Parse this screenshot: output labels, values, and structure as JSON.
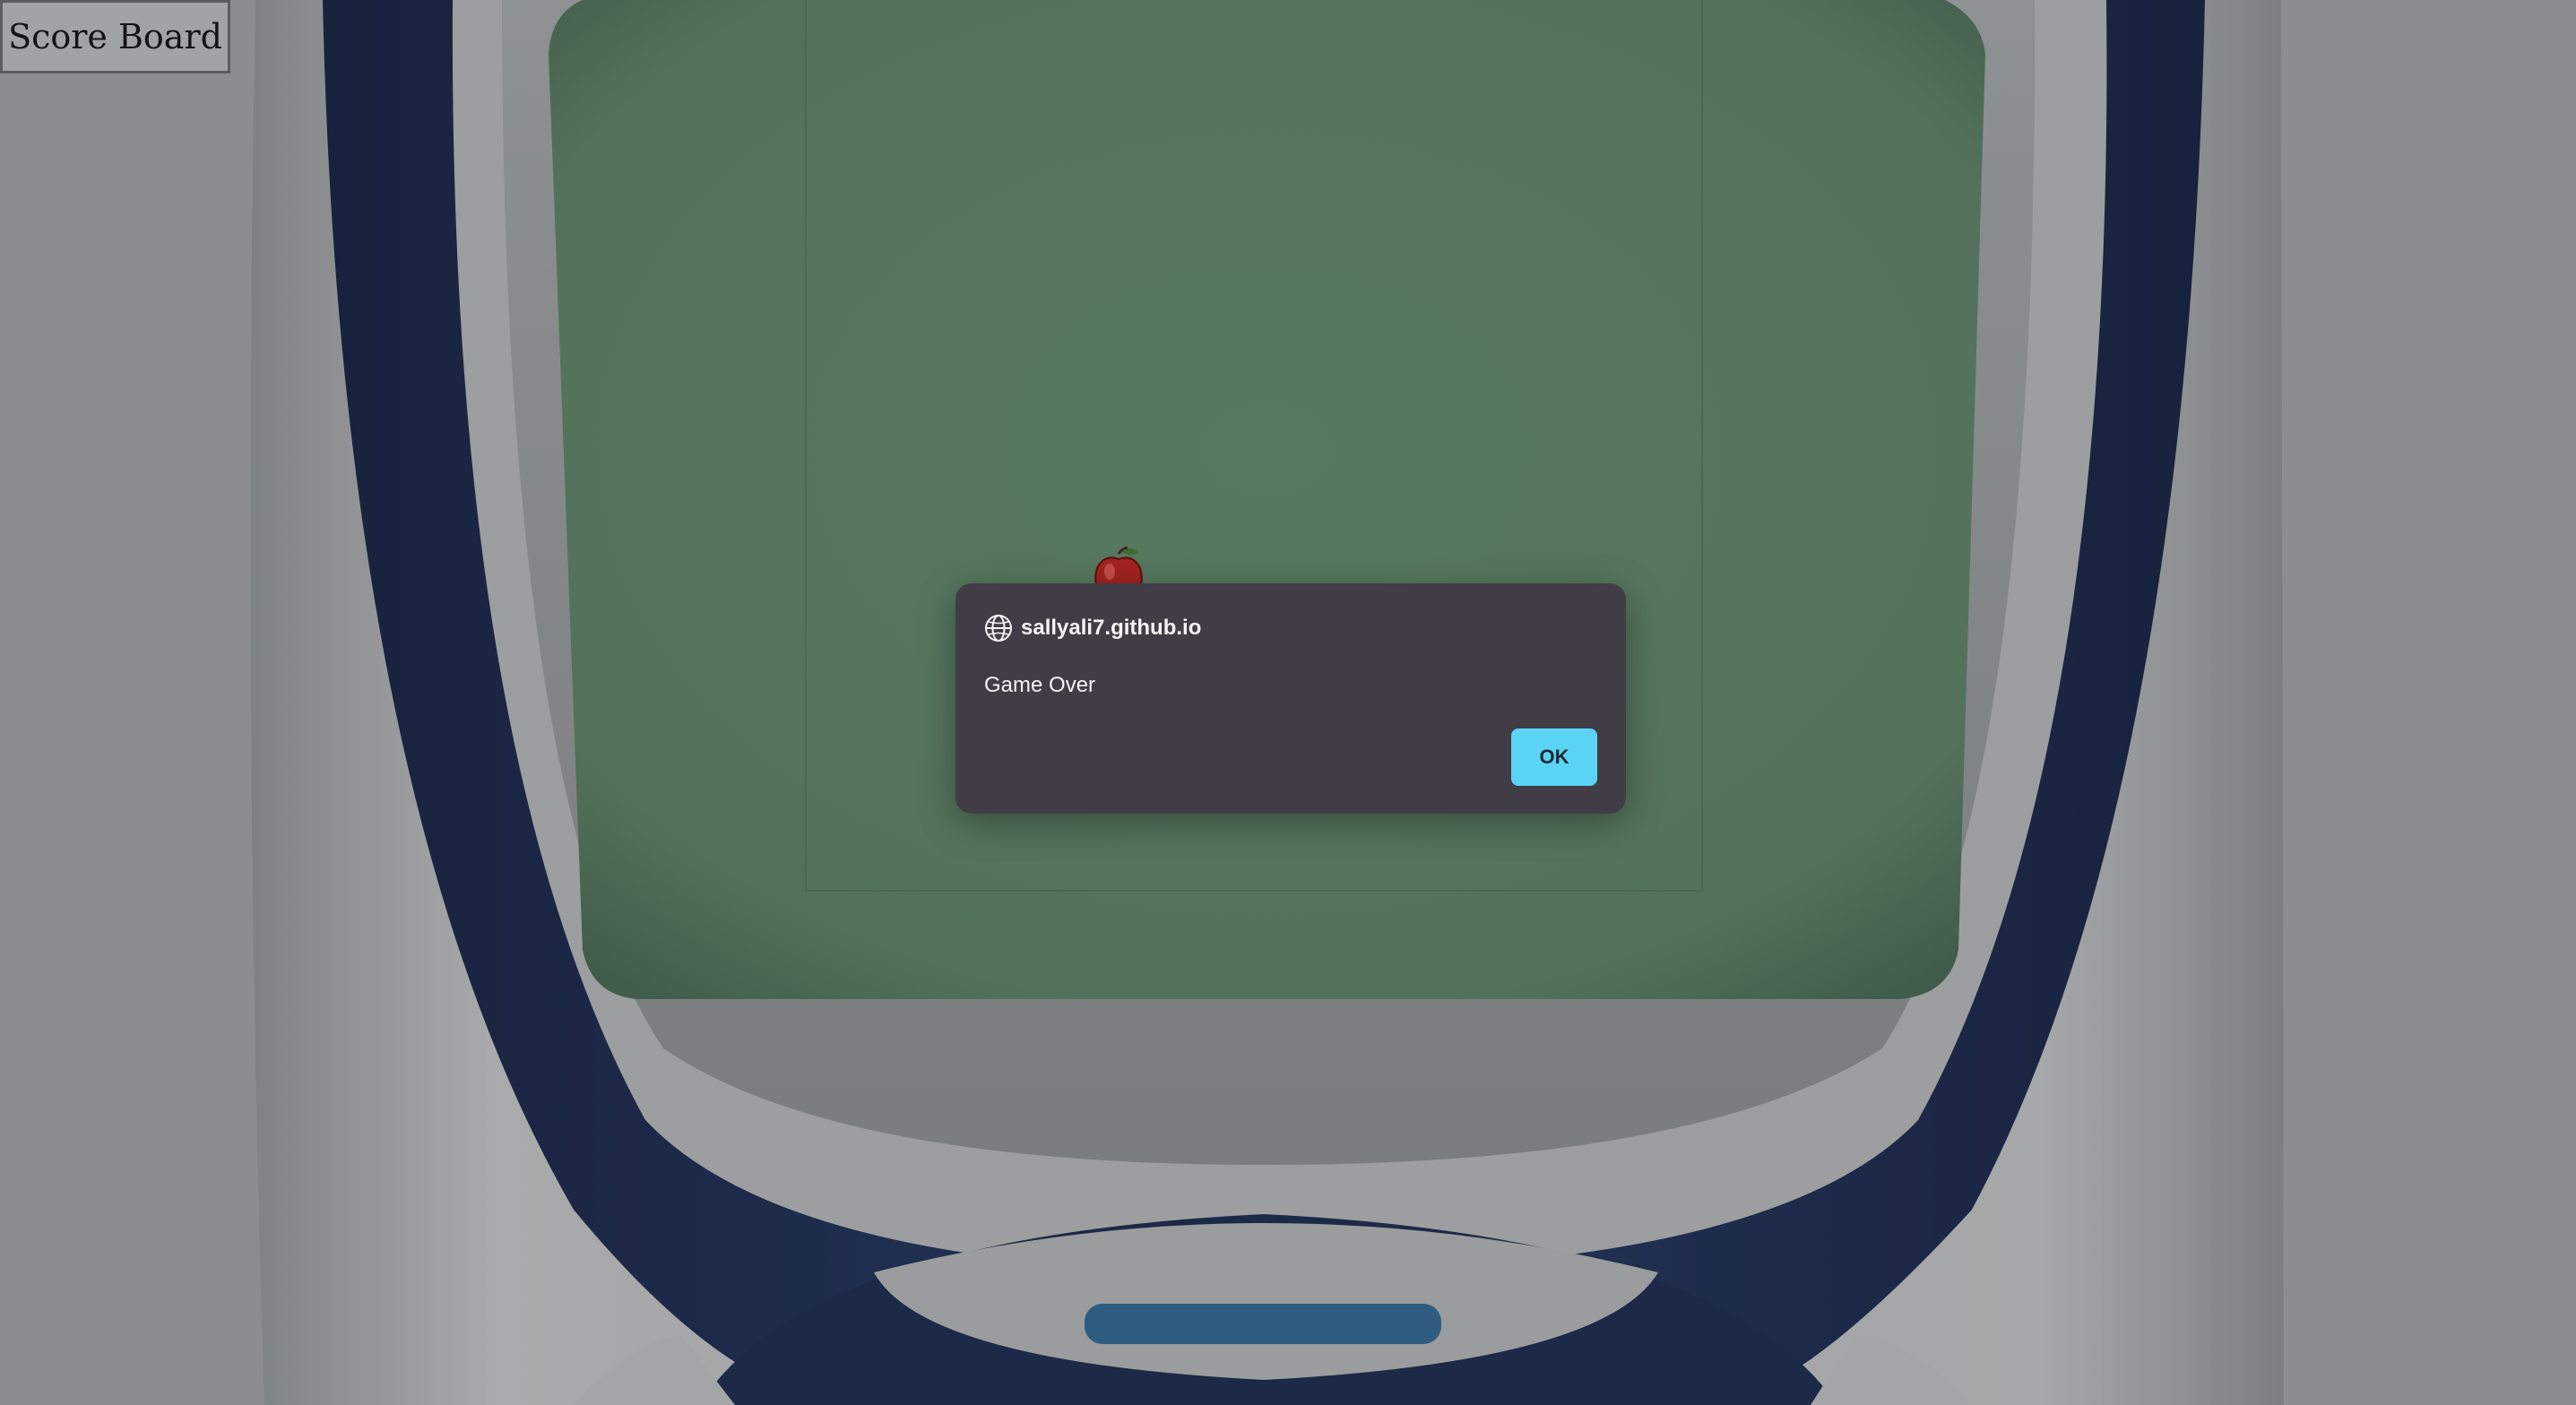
{
  "scoreboard": {
    "label": "Score Board"
  },
  "dialog": {
    "origin": "sallyali7.github.io",
    "message": "Game Over",
    "ok_label": "OK"
  },
  "icons": {
    "dialog": "globe-icon",
    "food": "apple-icon"
  },
  "colors": {
    "screen": "#577a60",
    "dialog_bg": "#403d46",
    "ok_button": "#5bd3f5",
    "phone_trim": "#1f2e4f",
    "background": "#8b8d8f"
  }
}
